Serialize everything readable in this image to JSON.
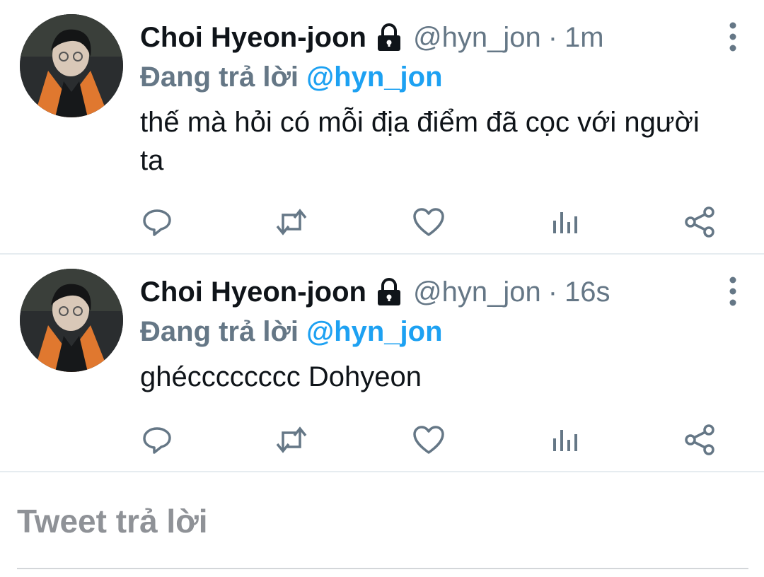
{
  "tweets": [
    {
      "display_name": "Choi Hyeon-joon",
      "handle": "@hyn_jon",
      "separator": "·",
      "time": "1m",
      "reply_prefix": "Đang trả lời",
      "reply_to": "@hyn_jon",
      "text": "thế mà hỏi có mỗi địa điểm đã cọc với người ta",
      "locked": true
    },
    {
      "display_name": "Choi Hyeon-joon",
      "handle": "@hyn_jon",
      "separator": "·",
      "time": "16s",
      "reply_prefix": "Đang trả lời",
      "reply_to": "@hyn_jon",
      "text": "ghécccccccc Dohyeon",
      "locked": true
    }
  ],
  "composer": {
    "placeholder": "Tweet trả lời"
  },
  "icons": {
    "lock": "lock-icon",
    "more": "more-vertical-icon",
    "reply": "reply-icon",
    "retweet": "retweet-icon",
    "like": "heart-icon",
    "analytics": "analytics-icon",
    "share": "share-icon"
  },
  "colors": {
    "link": "#1da1f2",
    "muted": "#657786",
    "text": "#0f1419",
    "divider": "#e6ecf0"
  }
}
